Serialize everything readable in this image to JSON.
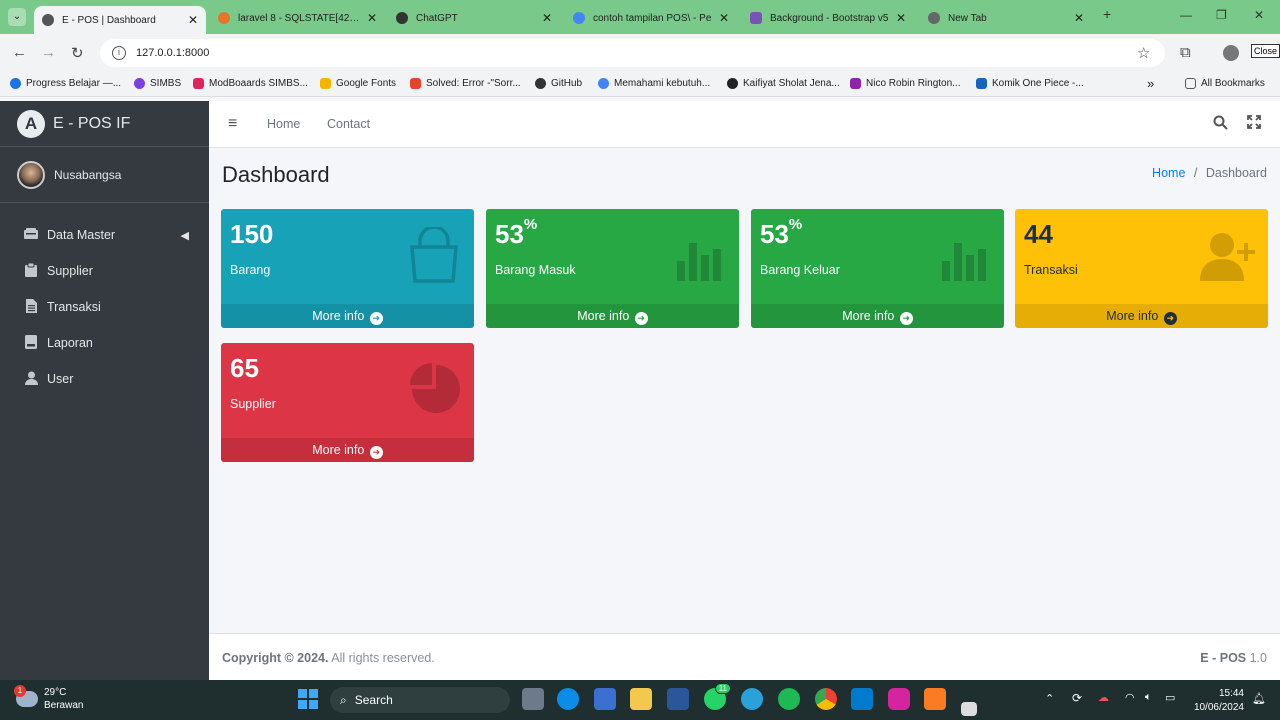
{
  "browser": {
    "tabs": [
      {
        "title": "E - POS | Dashboard",
        "active": true
      },
      {
        "title": "laravel 8 - SQLSTATE[42S02",
        "active": false
      },
      {
        "title": "ChatGPT",
        "active": false
      },
      {
        "title": "contoh tampilan POS\\ - Pe",
        "active": false
      },
      {
        "title": "Background - Bootstrap v5",
        "active": false
      },
      {
        "title": "New Tab",
        "active": false
      }
    ],
    "url": "127.0.0.1:8000",
    "close_tooltip": "Close",
    "bookmarks": [
      "Progress Belajar —...",
      "SIMBS",
      "ModBoaards SIMBS...",
      "Google Fonts",
      "Solved: Error -\"Sorr...",
      "GitHub",
      "Memahami kebutuh...",
      "Kaifiyat Sholat Jena...",
      "Nico Robin Rington...",
      "Komik One Piece -..."
    ],
    "all_bookmarks": "All Bookmarks"
  },
  "sidebar": {
    "brand": "E - POS IF",
    "brand_logo": "A",
    "user": "Nusabangsa",
    "items": [
      {
        "label": "Data Master",
        "icon": "database-icon"
      },
      {
        "label": "Supplier",
        "icon": "clipboard-icon"
      },
      {
        "label": "Transaksi",
        "icon": "file-icon"
      },
      {
        "label": "Laporan",
        "icon": "book-icon"
      },
      {
        "label": "User",
        "icon": "user-icon"
      }
    ]
  },
  "topnav": {
    "home": "Home",
    "contact": "Contact"
  },
  "header": {
    "title": "Dashboard",
    "crumb_home": "Home",
    "crumb_sep": "/",
    "crumb_current": "Dashboard"
  },
  "boxes": [
    {
      "value": "150",
      "suffix": "",
      "label": "Barang",
      "more": "More info",
      "color": "#17a2b8",
      "icon": "shopping-bag-icon"
    },
    {
      "value": "53",
      "suffix": "%",
      "label": "Barang Masuk",
      "more": "More info",
      "color": "#28a745",
      "icon": "bar-chart-icon"
    },
    {
      "value": "53",
      "suffix": "%",
      "label": "Barang Keluar",
      "more": "More info",
      "color": "#28a745",
      "icon": "bar-chart-icon"
    },
    {
      "value": "44",
      "suffix": "",
      "label": "Transaksi",
      "more": "More info",
      "color": "#ffc107",
      "icon": "user-plus-icon"
    },
    {
      "value": "65",
      "suffix": "",
      "label": "Supplier",
      "more": "More info",
      "color": "#dc3545",
      "icon": "pie-chart-icon"
    }
  ],
  "footer": {
    "copyright": "Copyright © 2024.",
    "rights": "All rights reserved.",
    "app": "E - POS",
    "version": "1.0"
  },
  "taskbar": {
    "temp": "29°C",
    "weather": "Berawan",
    "weather_badge": "1",
    "search": "Search",
    "time": "15:44",
    "date": "10/06/2024",
    "whatsapp_badge": "11"
  }
}
